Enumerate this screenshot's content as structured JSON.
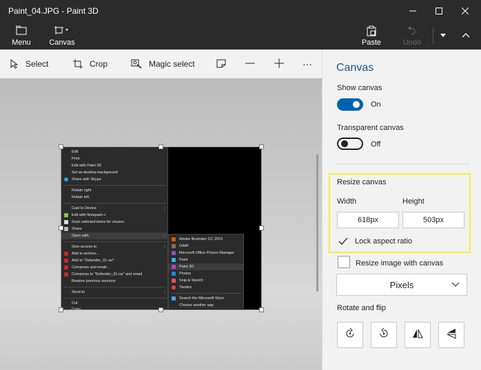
{
  "window": {
    "title": "Paint_04.JPG - Paint 3D",
    "controls": [
      "minimize",
      "maximize",
      "close"
    ]
  },
  "ribbon": {
    "menu_label": "Menu",
    "canvas_label": "Canvas",
    "paste_label": "Paste",
    "undo_label": "Undo"
  },
  "toolbar": {
    "select_label": "Select",
    "crop_label": "Crop",
    "magic_select_label": "Magic select",
    "more_label": "···"
  },
  "image_menu": {
    "items": [
      "Edit",
      "Print",
      "Edit with Paint 3D",
      "Set as desktop background",
      "Share with Skype",
      "Rotate right",
      "Rotate left",
      "Cast to Device",
      "Edit with Notepad++",
      "Scan selected items for viruses",
      "Share",
      "Open with",
      "Give access to",
      "Add to archive...",
      "Add to \"Defender_01.rar\"",
      "Compress and email...",
      "Compress to \"Defender_01.rar\" and email",
      "Restore previous versions",
      "Send to",
      "Cut",
      "Copy"
    ],
    "submenu": [
      "Adobe Illustrator CC 2015",
      "GIMP",
      "Microsoft Office Picture Manager",
      "Paint",
      "Paint 3D",
      "Photos",
      "Snip & Sketch",
      "Yandex",
      "Search the Microsoft Store",
      "Choose another app"
    ]
  },
  "panel": {
    "title": "Canvas",
    "show_canvas": {
      "label": "Show canvas",
      "state": "On"
    },
    "transparent_canvas": {
      "label": "Transparent canvas",
      "state": "Off"
    },
    "resize_canvas": {
      "heading": "Resize canvas",
      "width_label": "Width",
      "height_label": "Height",
      "width_value": "618px",
      "height_value": "503px",
      "lock_label": "Lock aspect ratio",
      "lock_checked": true
    },
    "resize_image": {
      "label": "Resize image with canvas",
      "checked": false
    },
    "units": {
      "selected": "Pixels"
    },
    "rotate_flip": {
      "heading": "Rotate and flip"
    }
  },
  "colors": {
    "accent": "#0063b1",
    "titlebar": "#2b2b2b",
    "highlight_box": "#ffeb3b",
    "panel_title": "#1a5a8a"
  }
}
